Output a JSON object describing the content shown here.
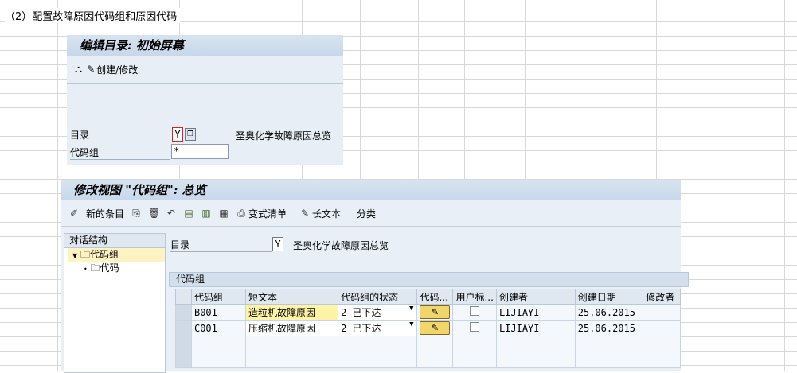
{
  "heading": "（2）配置故障原因代码组和原因代码",
  "initial_screen": {
    "title": "编辑目录: 初始屏幕",
    "toolbar_create_change": "创建/修改",
    "catalog_label": "目录",
    "catalog_value": "Y",
    "catalog_desc": "圣奥化学故障原因总览",
    "code_group_label": "代码组",
    "code_group_value": "*"
  },
  "change_view": {
    "title": "修改视图 \"代码组\": 总览",
    "toolbar": {
      "new_entries": "新的条目",
      "variant_list": "变式清单",
      "long_text": "长文本",
      "classification": "分类"
    },
    "nav": {
      "header": "对话结构",
      "items": [
        "代码组",
        "代码"
      ]
    },
    "catalog_label": "目录",
    "catalog_value": "Y",
    "catalog_desc": "圣奥化学故障原因总览",
    "group_label": "代码组",
    "columns": [
      "代码组",
      "短文本",
      "代码组的状态",
      "代码...",
      "用户标...",
      "创建者",
      "创建日期",
      "修改者"
    ],
    "rows": [
      {
        "code": "B001",
        "text": "造粒机故障原因",
        "status": "2 已下达",
        "creator": "LIJIAYI",
        "date": "25.06.2015"
      },
      {
        "code": "C001",
        "text": "压缩机故障原因",
        "status": "2 已下达",
        "creator": "LIJIAYI",
        "date": "25.06.2015"
      }
    ]
  }
}
